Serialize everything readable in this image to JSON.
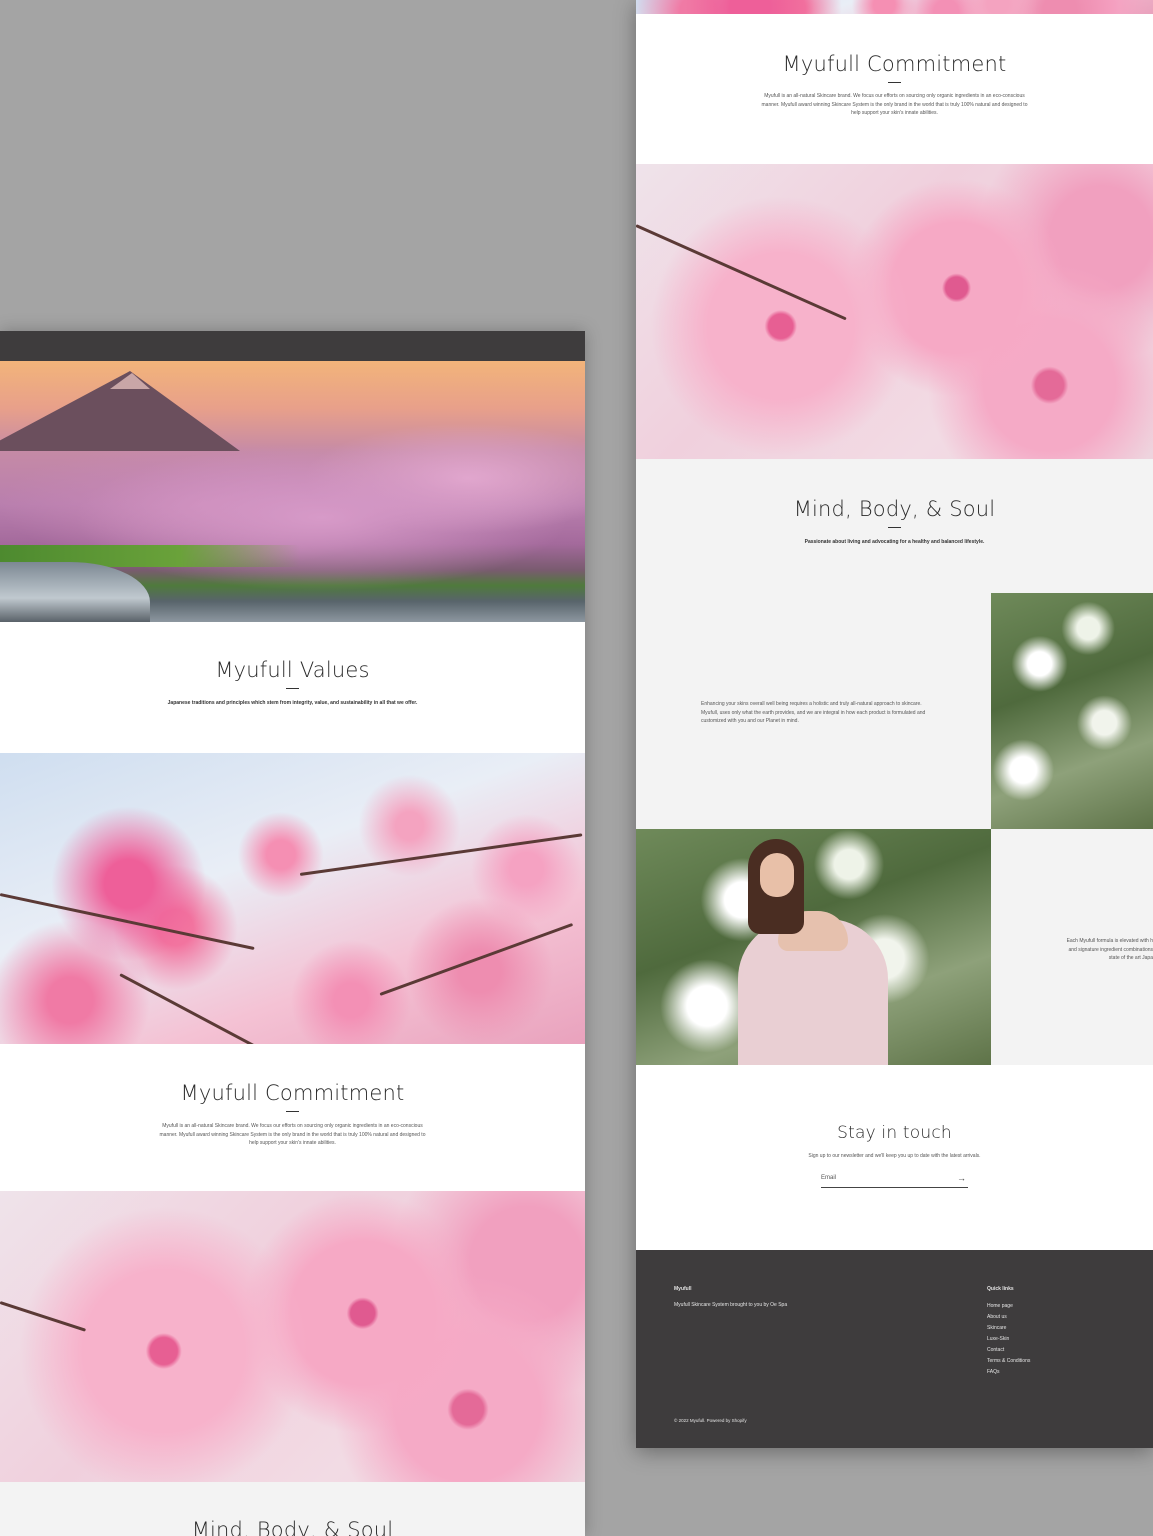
{
  "left_page": {
    "values": {
      "title": "Myufull Values",
      "text": "Japanese traditions and principles which stem from integrity, value, and sustainability in all that we offer."
    },
    "commitment": {
      "title": "Myufull Commitment",
      "text": "Myufull is an all-natural Skincare brand. We focus our efforts on sourcing only organic ingredients in an eco-conscious manner. Myufull award winning Skincare System is the only brand in the world that is truly 100% natural and designed to help support your skin's innate abilities."
    },
    "mind_body_soul": {
      "title": "Mind, Body, & Soul"
    }
  },
  "right_page": {
    "commitment": {
      "title": "Myufull Commitment",
      "text": "Myufull is an all-natural Skincare brand. We focus our efforts on sourcing only organic ingredients in an eco-conscious manner. Myufull award winning Skincare System is the only brand in the world that is truly 100% natural and designed to help support your skin's innate abilities."
    },
    "mind_body_soul": {
      "title": "Mind, Body, & Soul",
      "subtitle": "Passionate about living and advocating for a healthy and balanced lifestyle.",
      "text1": "Enhancing your skins overall well being requires a holistic and truly all-natural approach to skincare. Myufull, uses only what the earth provides, and we are integral in how each product is formulated and customized with you and our Planet in mind.",
      "text2_line1": "Each Myufull formula is elevated with h",
      "text2_line2": "and signature ingredient combinations",
      "text2_line3": "state of the art Japa"
    },
    "newsletter": {
      "title": "Stay in touch",
      "text": "Sign up to our newsletter and we'll keep you up to date with the latest arrivals.",
      "email_label": "Email",
      "arrow": "→"
    },
    "footer": {
      "brand_heading": "Myufull",
      "brand_text": "Myufull Skincare System brought to you by Oe Spa",
      "quick_links_heading": "Quick links",
      "links": [
        "Home page",
        "About us",
        "Skincare",
        "Luxe-Skin",
        "Contact",
        "Terms & Conditions",
        "FAQs"
      ],
      "copyright": "© 2022 Myufull. Powered by Shopify"
    }
  }
}
